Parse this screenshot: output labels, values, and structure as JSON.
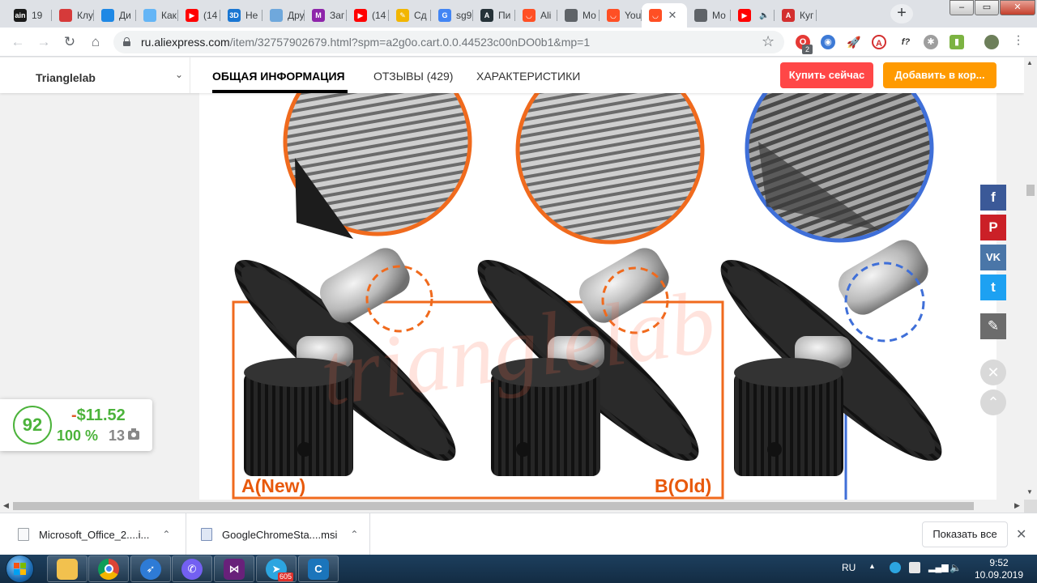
{
  "browser": {
    "tabs": [
      {
        "title": "19",
        "icon": "ain-icon",
        "color": "#1a1a1a",
        "glyph": "ain"
      },
      {
        "title": "Клу",
        "icon": "bird-icon",
        "color": "#d63a3a",
        "glyph": ""
      },
      {
        "title": "Ди",
        "icon": "shield-icon",
        "color": "#1e88e5",
        "glyph": ""
      },
      {
        "title": "Как",
        "icon": "diamond-icon",
        "color": "#64b5f6",
        "glyph": ""
      },
      {
        "title": "(14",
        "icon": "youtube-icon",
        "color": "#ff0000",
        "glyph": "▶"
      },
      {
        "title": "Не",
        "icon": "3d-icon",
        "color": "#1976d2",
        "glyph": "3D"
      },
      {
        "title": "Дру",
        "icon": "head-icon",
        "color": "#6fa8dc",
        "glyph": ""
      },
      {
        "title": "Заг",
        "icon": "mt-icon",
        "color": "#8e24aa",
        "glyph": "M"
      },
      {
        "title": "(14",
        "icon": "youtube-icon",
        "color": "#ff0000",
        "glyph": "▶"
      },
      {
        "title": "Сд",
        "icon": "pencil-icon",
        "color": "#f2b600",
        "glyph": "✎"
      },
      {
        "title": "sg9",
        "icon": "google-icon",
        "color": "#4285f4",
        "glyph": "G"
      },
      {
        "title": "Пи",
        "icon": "a-letter-icon",
        "color": "#263238",
        "glyph": "A"
      },
      {
        "title": "Ali",
        "icon": "aliexpress-icon",
        "color": "#ff4f24",
        "glyph": "◡"
      },
      {
        "title": "Мо",
        "icon": "globe-icon",
        "color": "#5f6368",
        "glyph": ""
      },
      {
        "title": "You",
        "icon": "aliexpress-icon",
        "color": "#ff4f24",
        "glyph": "◡"
      },
      {
        "title": "",
        "icon": "aliexpress-icon",
        "color": "#ff4f24",
        "glyph": "◡",
        "active": true
      },
      {
        "title": "Мо",
        "icon": "globe-icon",
        "color": "#5f6368",
        "glyph": ""
      },
      {
        "title": "",
        "icon": "youtube-icon",
        "color": "#ff0000",
        "glyph": "▶",
        "audio": true
      },
      {
        "title": "Куг",
        "icon": "a-red-icon",
        "color": "#d32f2f",
        "glyph": "A"
      }
    ],
    "new_tab_label": "+",
    "window_buttons": {
      "minimize": "–",
      "maximize": "▭",
      "close": "✕"
    },
    "url_host": "ru.aliexpress.com",
    "url_rest": "/item/32757902679.html?spm=a2g0o.cart.0.0.44523c00nDO0b1&mp=1",
    "ext_badge": "2"
  },
  "page": {
    "store_name": "Trianglelab",
    "tabs": [
      {
        "label": "ОБЩАЯ ИНФОРМАЦИЯ",
        "active": true
      },
      {
        "label": "ОТЗЫВЫ (429)",
        "active": false
      },
      {
        "label": "ХАРАКТЕРИСТИКИ",
        "active": false
      }
    ],
    "buy_now": "Купить сейчас",
    "add_to_cart": "Добавить в кор...",
    "image": {
      "label_new": "A(New)",
      "label_old": "B(Old)",
      "watermark": "trianglelab",
      "colors": {
        "orange": "#f06a1d",
        "blue": "#3f6fd8",
        "gear": "#202020"
      }
    },
    "share": {
      "facebook": "f",
      "pinterest": "P",
      "vk": "VK",
      "twitter": "t",
      "edit": "✎",
      "close": "✕",
      "up": "⌃"
    },
    "price_widget": {
      "score": "92",
      "price_sign": "-",
      "price_drop": "$11.52",
      "percent": "100 %",
      "reviews": "13"
    }
  },
  "downloads": {
    "items": [
      {
        "name": "Microsoft_Office_2....i..."
      },
      {
        "name": "GoogleChromeSta....msi"
      }
    ],
    "show_all": "Показать все"
  },
  "taskbar": {
    "telegram_badge": "605",
    "lang": "RU",
    "time": "9:52",
    "date": "10.09.2019"
  }
}
